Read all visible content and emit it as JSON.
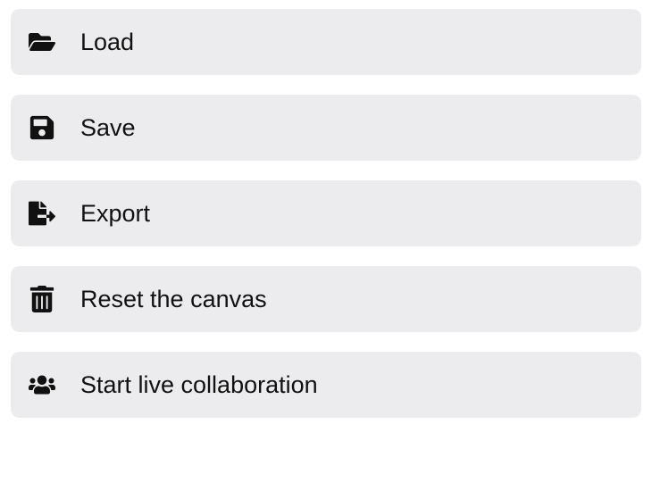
{
  "menu": {
    "items": [
      {
        "label": "Load",
        "icon": "folder-open-icon"
      },
      {
        "label": "Save",
        "icon": "save-icon"
      },
      {
        "label": "Export",
        "icon": "export-icon"
      },
      {
        "label": "Reset the canvas",
        "icon": "trash-icon"
      },
      {
        "label": "Start live collaboration",
        "icon": "users-icon"
      }
    ]
  }
}
